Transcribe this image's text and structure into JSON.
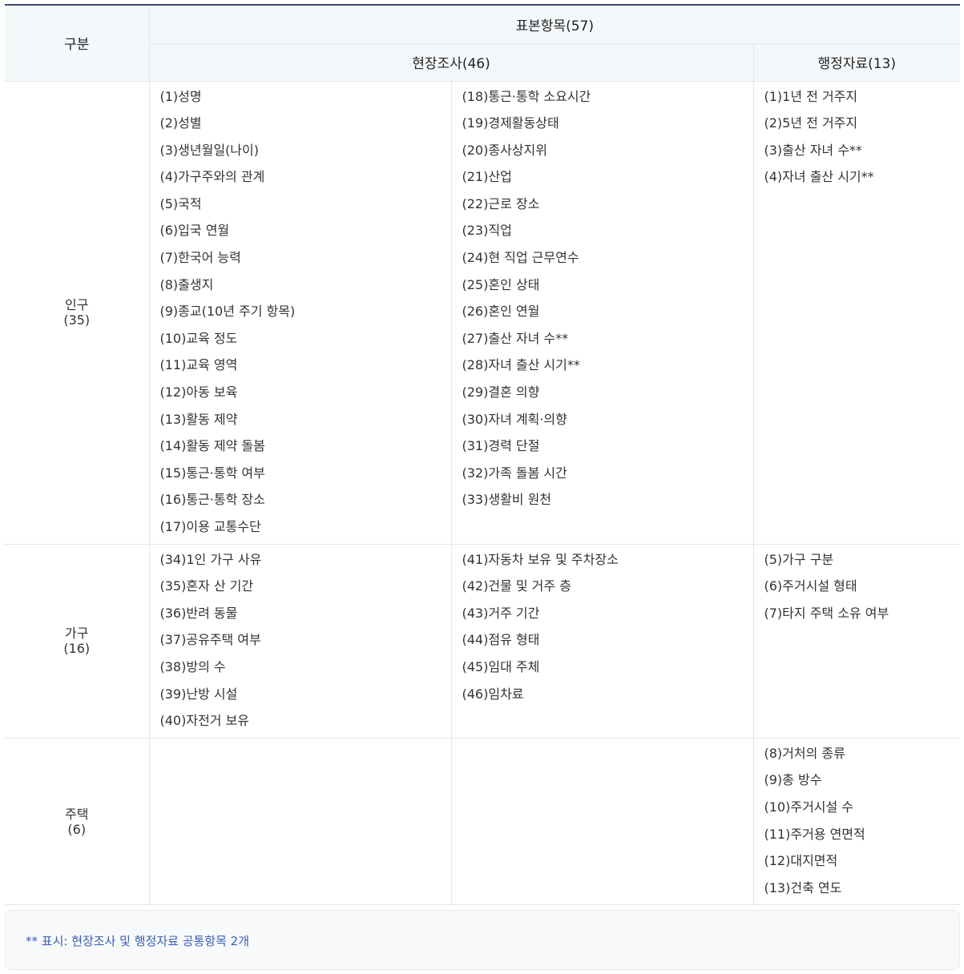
{
  "header": {
    "category_label": "구분",
    "standard_label": "표본항목(57)",
    "field_label": "현장조사(46)",
    "admin_label": "행정자료(13)"
  },
  "rows": [
    {
      "category": "인구",
      "count": "(35)",
      "field_col1": [
        "(1)성명",
        "(2)성별",
        "(3)생년월일(나이)",
        "(4)가구주와의 관계",
        "(5)국적",
        "(6)입국 연월",
        "(7)한국어 능력",
        "(8)출생지",
        "(9)종교(10년 주기 항목)",
        "(10)교육 정도",
        "(11)교육 영역",
        "(12)아동 보육",
        "(13)활동 제약",
        "(14)활동 제약 돌봄",
        "(15)통근·통학 여부",
        "(16)통근·통학 장소",
        "(17)이용 교통수단"
      ],
      "field_col2": [
        "(18)통근·통학 소요시간",
        "(19)경제활동상태",
        "(20)종사상지위",
        "(21)산업",
        "(22)근로 장소",
        "(23)직업",
        "(24)현 직업 근무연수",
        "(25)혼인 상태",
        "(26)혼인 연월",
        "(27)출산 자녀 수**",
        "(28)자녀 출산 시기**",
        "(29)결혼 의향",
        "(30)자녀 계획·의향",
        "(31)경력 단절",
        "(32)가족 돌봄 시간",
        "(33)생활비 원천"
      ],
      "admin": [
        "(1)1년 전 거주지",
        "(2)5년 전 거주지",
        "(3)출산 자녀 수**",
        "(4)자녀 출산 시기**"
      ]
    },
    {
      "category": "가구",
      "count": "(16)",
      "field_col1": [
        "(34)1인 가구 사유",
        "(35)혼자 산 기간",
        "(36)반려 동물",
        "(37)공유주택 여부",
        "(38)방의 수",
        "(39)난방 시설",
        "(40)자전거 보유"
      ],
      "field_col2": [
        "(41)자동차 보유 및 주차장소",
        "(42)건물 및 거주 층",
        "(43)거주 기간",
        "(44)점유 형태",
        "(45)임대 주체",
        "(46)임차료"
      ],
      "admin": [
        "(5)가구 구분",
        "(6)주거시설 형태",
        "(7)타지 주택 소유 여부"
      ]
    },
    {
      "category": "주택",
      "count": "(6)",
      "field_col1": [],
      "field_col2": [],
      "admin": [
        "(8)거처의 종류",
        "(9)총 방수",
        "(10)주거시설 수",
        "(11)주거용 연면적",
        "(12)대지면적",
        "(13)건축 연도"
      ]
    }
  ],
  "note": "** 표시: 현장조사 및 행정자료 공통항목 2개"
}
